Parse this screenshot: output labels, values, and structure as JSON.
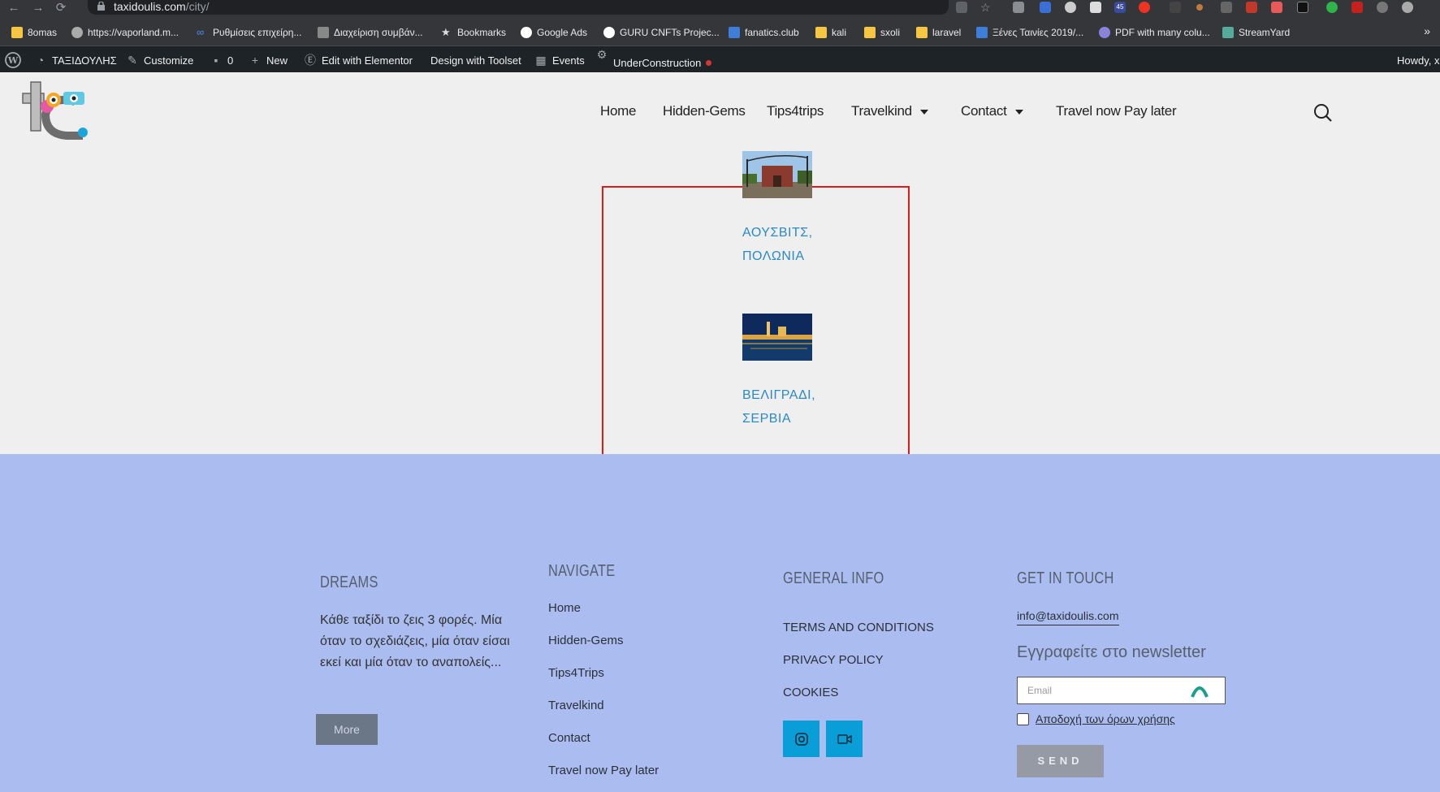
{
  "browser": {
    "url_host": "taxidoulis.com",
    "url_path": "/city/",
    "bookmarks": [
      {
        "label": "8omas"
      },
      {
        "label": "https://vaporland.m..."
      },
      {
        "label": "Ρυθμίσεις επιχείρη..."
      },
      {
        "label": "Διαχείριση συμβάν..."
      },
      {
        "label": "Bookmarks"
      },
      {
        "label": "Google Ads"
      },
      {
        "label": "GURU CNFTs Projec..."
      },
      {
        "label": "fanatics.club"
      },
      {
        "label": "kali"
      },
      {
        "label": "sxoli"
      },
      {
        "label": "laravel"
      },
      {
        "label": "Ξένες Ταινίες 2019/..."
      },
      {
        "label": "PDF with many colu..."
      },
      {
        "label": "StreamYard"
      }
    ],
    "bookmarks_more": "»",
    "ext_badge": "45"
  },
  "adminbar": {
    "site_name": "ΤΑΞΙΔΟΥΛΗΣ",
    "customize": "Customize",
    "comments": "0",
    "new": "New",
    "elementor": "Edit with Elementor",
    "toolset": "Design with Toolset",
    "events": "Events",
    "under_construction": "UnderConstruction",
    "howdy": "Howdy, x"
  },
  "nav": {
    "items": [
      "Home",
      "Hidden-Gems",
      "Tips4trips",
      "Travelkind",
      "Contact",
      "Travel now Pay later"
    ]
  },
  "cities": [
    {
      "name_line1": "ΑΟΥΣΒΙΤΣ,",
      "name_line2": "ΠΟΛΩΝΙΑ"
    },
    {
      "name_line1": "ΒΕΛΙΓΡΑΔΙ,",
      "name_line2": "ΣΕΡΒΙΑ"
    }
  ],
  "footer": {
    "dreams": {
      "heading": "DREAMS",
      "text": "Κάθε ταξίδι το ζεις 3 φορές. Μία όταν το σχεδιάζεις, μία όταν είσαι εκεί και μία όταν το αναπολείς...",
      "more": "More"
    },
    "navigate": {
      "heading": "NAVIGATE",
      "links": [
        "Home",
        "Hidden-Gems",
        "Tips4Trips",
        "Travelkind",
        "Contact",
        "Travel now Pay later"
      ]
    },
    "general": {
      "heading": "GENERAL INFO",
      "links": [
        "TERMS AND CONDITIONS",
        "PRIVACY POLICY",
        "COOKIES"
      ]
    },
    "touch": {
      "heading": "GET IN TOUCH",
      "email": "info@taxidoulis.com",
      "newsletter_prefix": "Εγγραφείτε στο",
      "newsletter_word": "newsletter",
      "email_placeholder": "Email",
      "terms": "Αποδοχή των όρων χρήσης",
      "send": "SEND"
    }
  },
  "colors": {
    "footer_bg": "#abbdf0",
    "link_blue": "#2a8ac6",
    "highlight_red": "#e0191b",
    "social_blue": "#0a9ed8"
  }
}
